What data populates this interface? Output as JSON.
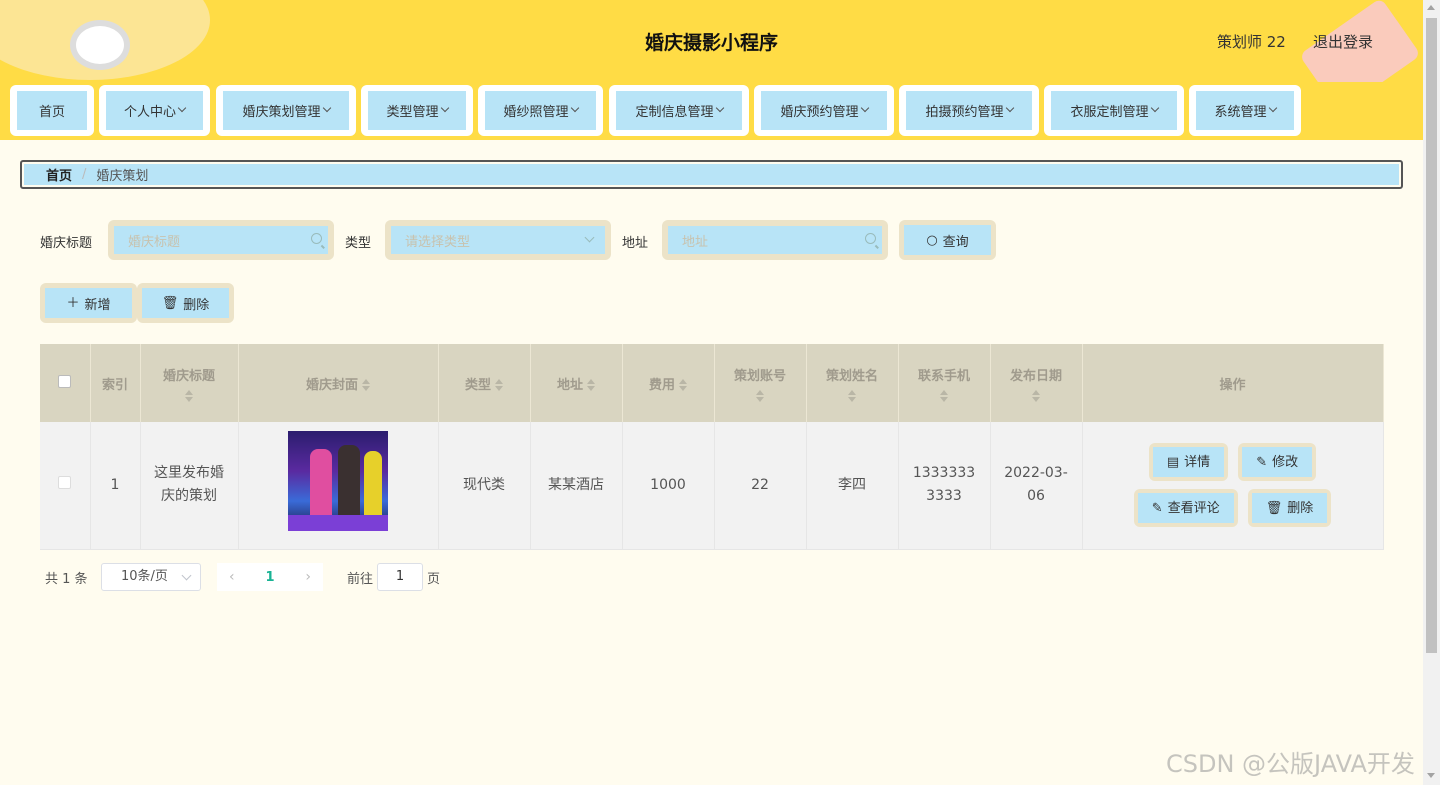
{
  "header": {
    "title": "婚庆摄影小程序",
    "user": "策划师 22",
    "logout": "退出登录"
  },
  "nav": [
    {
      "label": "首页",
      "dropdown": false
    },
    {
      "label": "个人中心",
      "dropdown": true
    },
    {
      "label": "婚庆策划管理",
      "dropdown": true
    },
    {
      "label": "类型管理",
      "dropdown": true
    },
    {
      "label": "婚纱照管理",
      "dropdown": true
    },
    {
      "label": "定制信息管理",
      "dropdown": true
    },
    {
      "label": "婚庆预约管理",
      "dropdown": true
    },
    {
      "label": "拍摄预约管理",
      "dropdown": true
    },
    {
      "label": "衣服定制管理",
      "dropdown": true
    },
    {
      "label": "系统管理",
      "dropdown": true
    }
  ],
  "breadcrumb": {
    "home": "首页",
    "separator": "/",
    "current": "婚庆策划"
  },
  "search": {
    "title_label": "婚庆标题",
    "title_placeholder": "婚庆标题",
    "type_label": "类型",
    "type_placeholder": "请选择类型",
    "address_label": "地址",
    "address_placeholder": "地址",
    "query_button": "查询"
  },
  "actions": {
    "add": "新增",
    "delete": "删除"
  },
  "table": {
    "headers": {
      "index": "索引",
      "title": "婚庆标题",
      "cover": "婚庆封面",
      "type": "类型",
      "address": "地址",
      "cost": "费用",
      "account": "策划账号",
      "name": "策划姓名",
      "phone": "联系手机",
      "date": "发布日期",
      "ops": "操作"
    },
    "rows": [
      {
        "index": "1",
        "title": "这里发布婚庆的策划",
        "type": "现代类",
        "address": "某某酒店",
        "cost": "1000",
        "account": "22",
        "name": "李四",
        "phone": "13333333333",
        "date": "2022-03-06",
        "ops": {
          "detail": "详情",
          "edit": "修改",
          "comments": "查看评论",
          "delete": "删除"
        }
      }
    ]
  },
  "pagination": {
    "total": "共 1 条",
    "page_size": "10条/页",
    "current_page": "1",
    "goto_label": "前往",
    "goto_value": "1",
    "page_suffix": "页"
  },
  "watermark": "CSDN @公版JAVA开发",
  "colors": {
    "header": "#ffdc45",
    "button": "#b8e4f7",
    "button_border": "#ece3c8",
    "page_bg": "#fffcef",
    "accent": "#19b394"
  }
}
